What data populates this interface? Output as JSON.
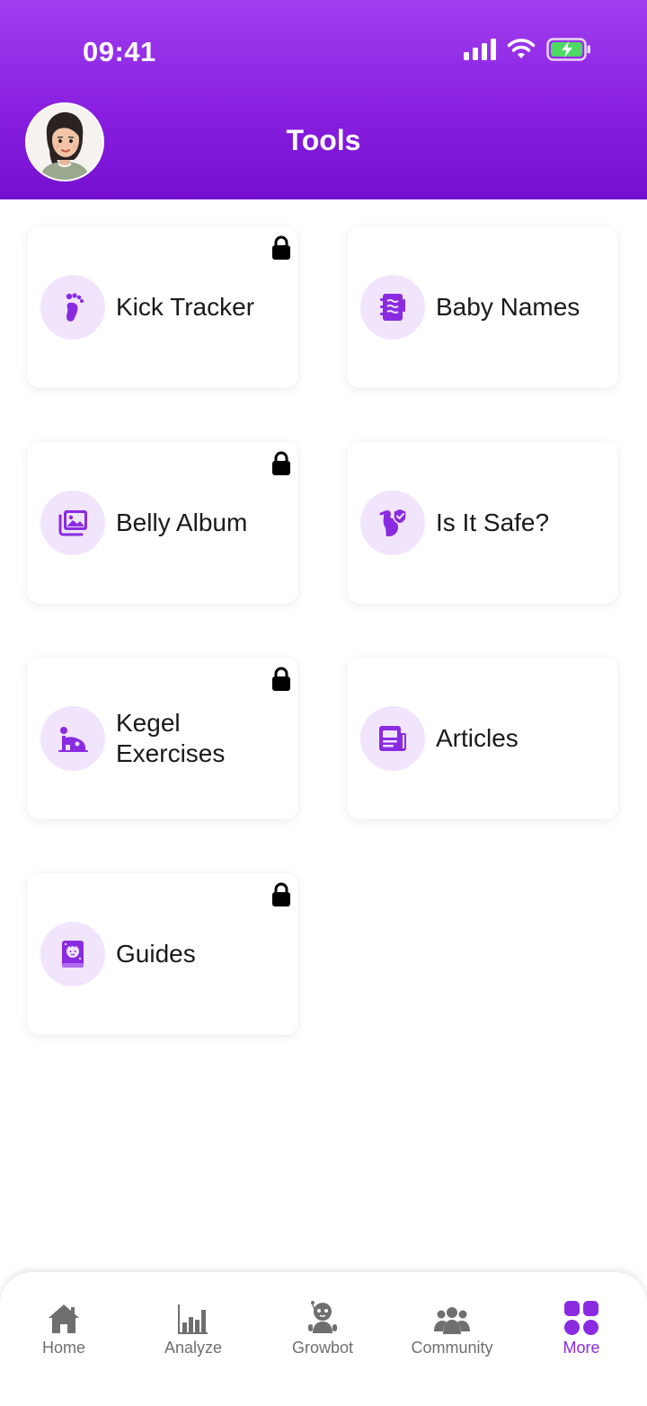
{
  "status_bar": {
    "time": "09:41"
  },
  "header": {
    "title": "Tools"
  },
  "tools": [
    {
      "label": "Kick Tracker",
      "icon": "footprint-icon",
      "locked": true
    },
    {
      "label": "Baby Names",
      "icon": "notebook-icon",
      "locked": false
    },
    {
      "label": "Belly Album",
      "icon": "photo-album-icon",
      "locked": true
    },
    {
      "label": "Is It Safe?",
      "icon": "pregnant-shield-icon",
      "locked": false
    },
    {
      "label": "Kegel Exercises",
      "icon": "kegel-exercise-icon",
      "locked": true
    },
    {
      "label": "Articles",
      "icon": "newspaper-icon",
      "locked": false
    },
    {
      "label": "Guides",
      "icon": "baby-guide-book-icon",
      "locked": true
    }
  ],
  "nav": [
    {
      "label": "Home",
      "icon": "home-icon",
      "active": false
    },
    {
      "label": "Analyze",
      "icon": "bar-chart-icon",
      "active": false
    },
    {
      "label": "Growbot",
      "icon": "robot-icon",
      "active": false
    },
    {
      "label": "Community",
      "icon": "people-icon",
      "active": false
    },
    {
      "label": "More",
      "icon": "grid-icon",
      "active": true
    }
  ],
  "colors": {
    "header_gradient_top": "#a03ff0",
    "header_gradient_bottom": "#7410d0",
    "accent": "#8a2be2",
    "icon_circle_bg": "#f1e4fd",
    "nav_inactive": "#6f6f6f"
  }
}
